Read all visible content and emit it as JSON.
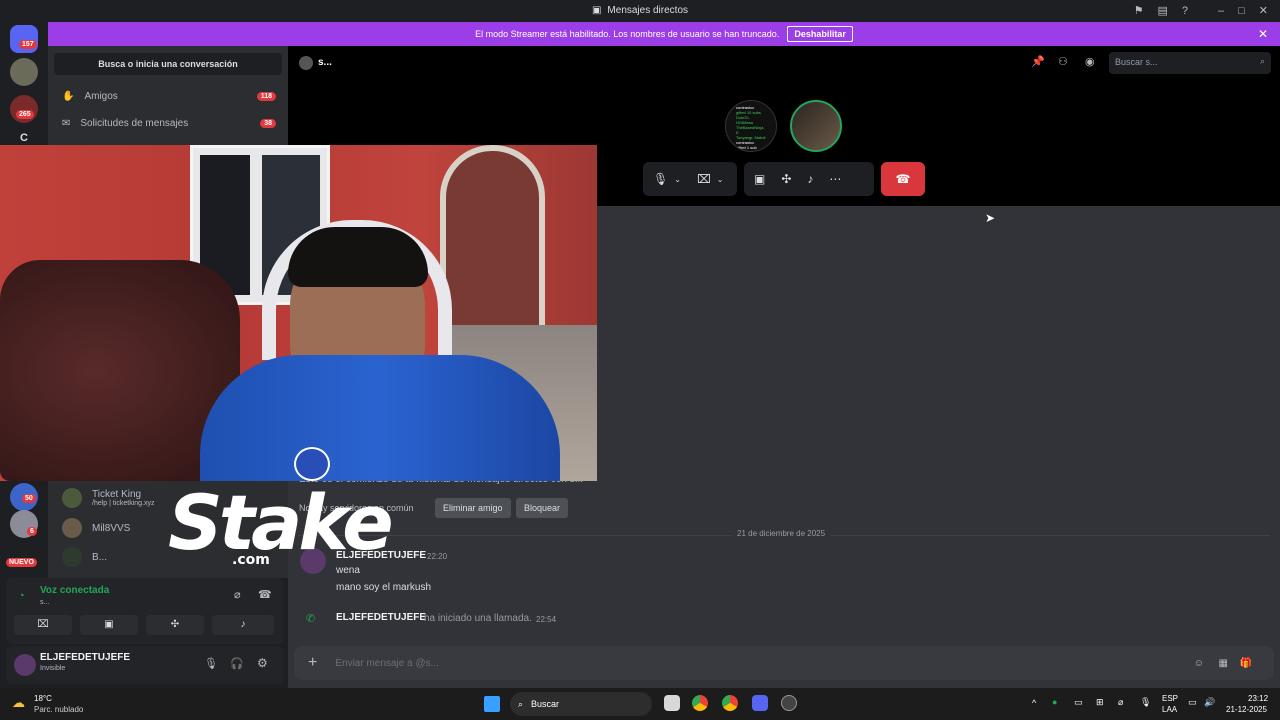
{
  "window": {
    "title": "Mensajes directos"
  },
  "banner": {
    "text": "El modo Streamer está habilitado. Los nombres de usuario se han truncado.",
    "button": "Deshabilitar"
  },
  "servers": {
    "badges": [
      "157",
      "265",
      "50",
      "6"
    ],
    "new_label": "NUEVO",
    "letter": "C"
  },
  "dm_sidebar": {
    "search": "Busca o inicia una conversación",
    "friends": "Amigos",
    "friends_count": "118",
    "requests": "Solicitudes de mensajes",
    "requests_count": "38",
    "dms": [
      {
        "name": "Ticket King",
        "sub": "/help | ticketking.xyz"
      },
      {
        "name": "Mil8VVS",
        "sub": ""
      },
      {
        "name": "B...",
        "sub": ""
      }
    ]
  },
  "voice": {
    "status": "Voz conectada",
    "channel": "s..."
  },
  "user": {
    "name": "ELJEFEDETUJEFE",
    "status": "Invisible"
  },
  "header": {
    "channel": "s...",
    "search_placeholder": "Buscar s..."
  },
  "call": {
    "tile_text": [
      "contrastcc",
      "gifted 10 subs",
      "DokO0, HOtMesa",
      "TheBasedNinja, E",
      "Tonyangr, Mahdi",
      "contrastcc",
      "gifted 1 sub"
    ]
  },
  "chat": {
    "intro": "Este es el comienzo de tu historial de mensajes directos con s...",
    "common": "No hay servidores en común",
    "remove_friend": "Eliminar amigo",
    "block": "Bloquear",
    "date": "21 de diciembre de 2025",
    "author": "ELJEFEDETUJEFE",
    "time": "22:20",
    "lines": [
      "wena",
      "mano soy el markush"
    ],
    "call_author": "ELJEFEDETUJEFE",
    "call_text": "ha iniciado una llamada.",
    "call_time": "22:54"
  },
  "composer": {
    "placeholder": "Enviar mensaje a @s..."
  },
  "overlay": {
    "brand": "Stake",
    "domain": ".com"
  },
  "taskbar": {
    "weather_temp": "18°C",
    "weather_desc": "Parc. nublado",
    "search": "Buscar",
    "lang1": "ESP",
    "lang2": "LAA",
    "time": "23:12",
    "date": "21-12-2025"
  }
}
